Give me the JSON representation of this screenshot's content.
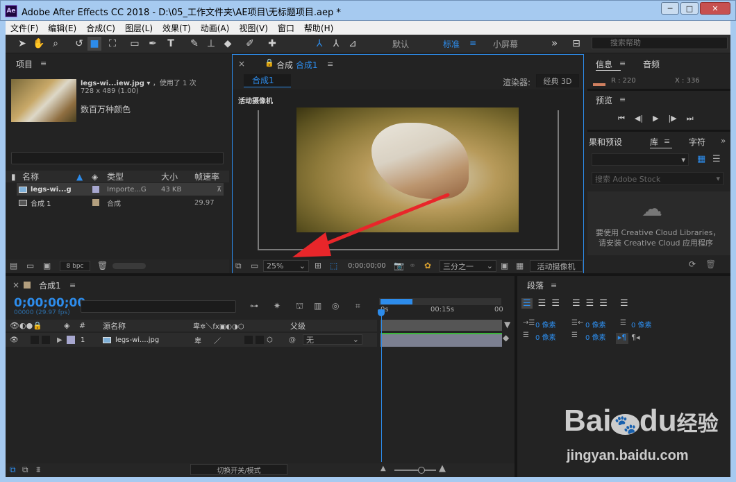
{
  "window": {
    "title": "Adobe After Effects CC 2018 - D:\\05_工作文件夹\\AE项目\\无标题项目.aep *",
    "app_icon": "Ae",
    "minimize": "─",
    "maximize": "□",
    "close": "✕"
  },
  "menu": [
    "文件(F)",
    "编辑(E)",
    "合成(C)",
    "图层(L)",
    "效果(T)",
    "动画(A)",
    "视图(V)",
    "窗口",
    "帮助(H)"
  ],
  "toolbar": {
    "workspaces": {
      "default": "默认",
      "standard": "标准",
      "small": "小屏幕"
    },
    "more": "»",
    "search_placeholder": "搜索帮助"
  },
  "project": {
    "title": "项目",
    "asset_name": "legs-wi...iew.jpg",
    "asset_suffix": "，使用了 1 次",
    "asset_dims": "728 x 489 (1.00)",
    "asset_color": "数百万种颜色",
    "columns": {
      "name": "名称",
      "type": "类型",
      "size": "大小",
      "fps": "帧速率"
    },
    "items": [
      {
        "name": "legs-wi...g",
        "type": "Importe...G",
        "size": "43 KB",
        "fps": "",
        "color": "#a7a7cf",
        "kind": "image"
      },
      {
        "name": "合成 1",
        "type": "合成",
        "size": "",
        "fps": "29.97",
        "color": "#b39f7e",
        "kind": "comp"
      }
    ],
    "bpc": "8 bpc"
  },
  "composition": {
    "panel_label": "合成",
    "comp_name": "合成1",
    "tab": "合成1",
    "renderer_label": "渲染器:",
    "renderer": "经典 3D",
    "camera_label": "活动摄像机",
    "zoom": "25%",
    "timecode": "0;00;00;00",
    "resolution": "三分之一",
    "view": "活动摄像机"
  },
  "info": {
    "tab_info": "信息",
    "tab_audio": "音频",
    "r": "R : 220",
    "x": "X : 336"
  },
  "preview": {
    "title": "预览",
    "controls": [
      "⏮",
      "◀|",
      "▶",
      "|▶",
      "⏭"
    ]
  },
  "library": {
    "tab_effects": "果和预设",
    "tab_library": "库",
    "tab_char": "字符",
    "search_placeholder": "搜索 Adobe Stock",
    "message_line1": "要使用 Creative Cloud Libraries，",
    "message_line2": "请安装 Creative Cloud 应用程序"
  },
  "timeline": {
    "tab": "合成1",
    "timecode": "0;00;00;00",
    "fps_note": "00000 (29.97 fps)",
    "columns": {
      "num": "#",
      "source": "源名称",
      "parent": "父级"
    },
    "layer": {
      "num": "1",
      "name": "legs-wi....jpg",
      "parent": "无",
      "color": "#a7a7cf"
    },
    "ruler": {
      "start": "0s",
      "mid": "00:15s",
      "end": "00"
    },
    "toggle_label": "切换开关/模式"
  },
  "paragraph": {
    "title": "段落",
    "fields": [
      "0 像素",
      "0 像素",
      "0 像素",
      "0 像素",
      "0 像素"
    ]
  },
  "watermark": {
    "brand": "Bai",
    "brand2": "du",
    "brand3": "经验",
    "url": "jingyan.baidu.com"
  }
}
